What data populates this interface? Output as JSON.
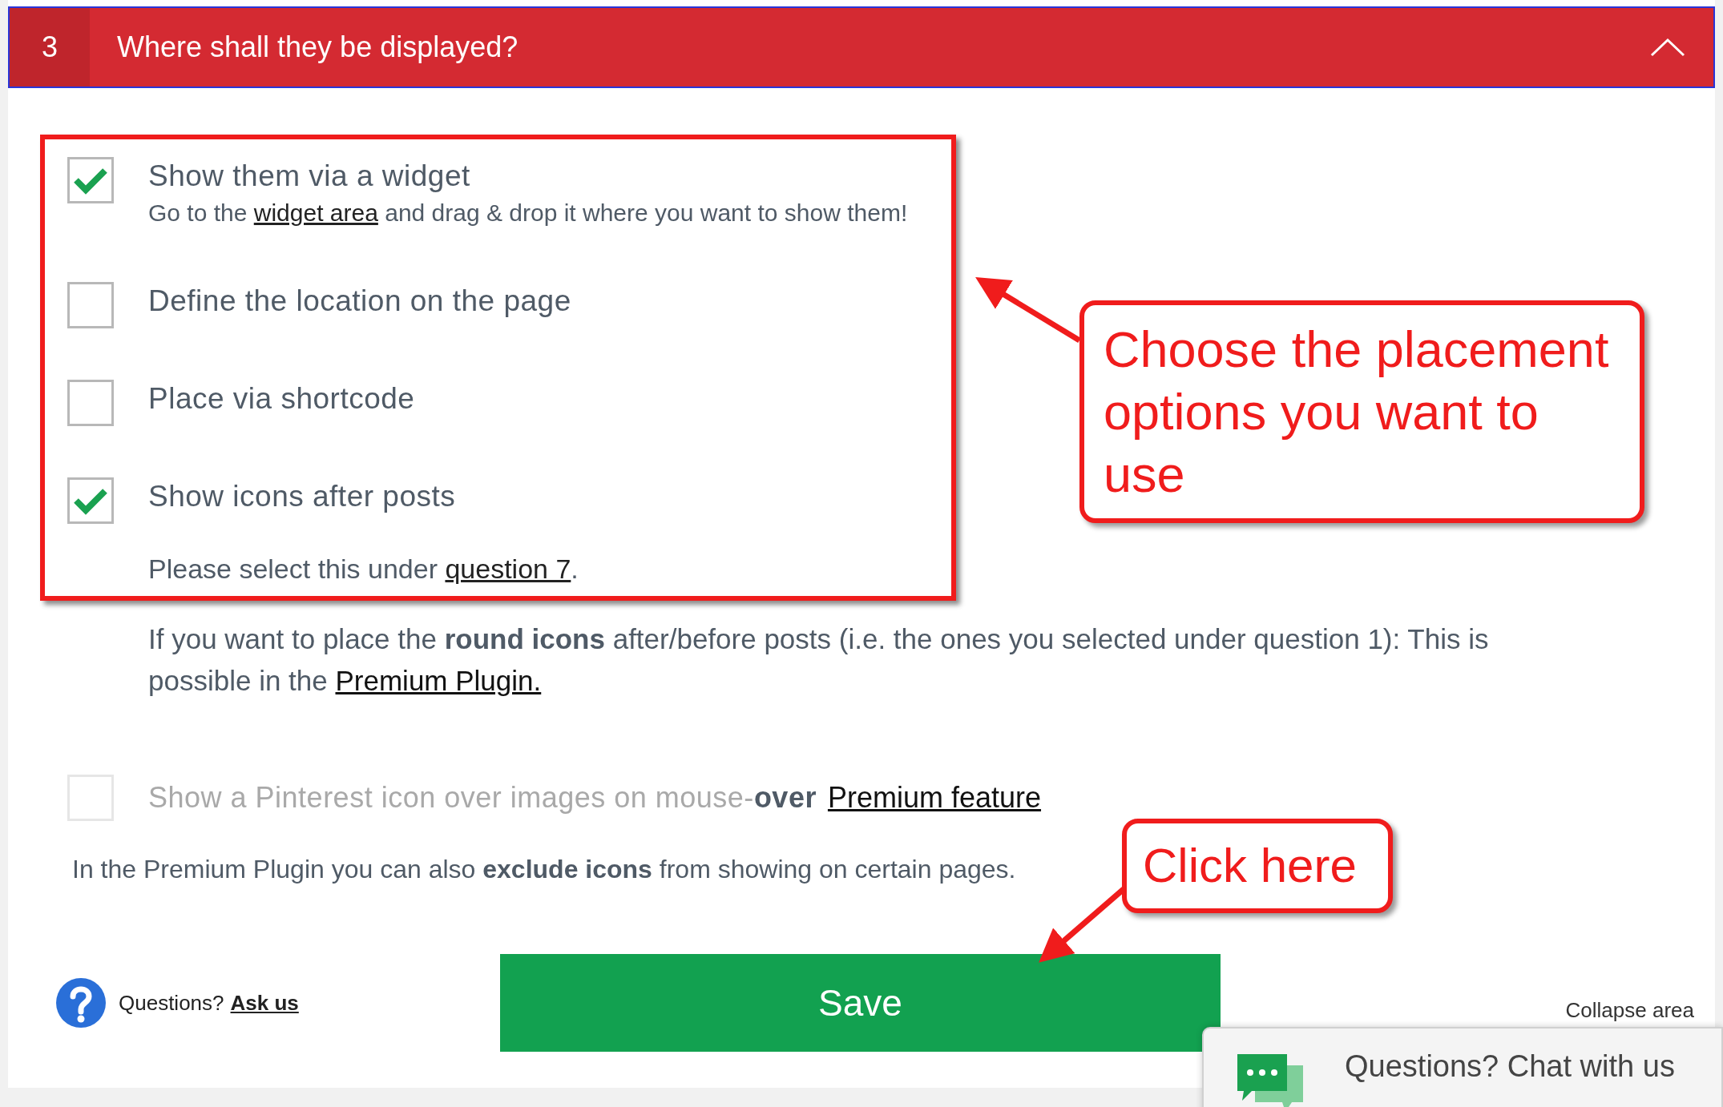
{
  "section": {
    "number": "3",
    "title": "Where shall they be displayed?",
    "expanded": true
  },
  "options": [
    {
      "label": "Show them via a widget",
      "checked": true,
      "note": {
        "before": "Go to the ",
        "link": "widget area",
        "after": " and drag & drop it where you want to show them!"
      }
    },
    {
      "label": "Define the location on the page",
      "checked": false
    },
    {
      "label": "Place via shortcode",
      "checked": false
    },
    {
      "label": "Show icons after posts",
      "checked": true
    }
  ],
  "options_note": {
    "before": "Please select this under ",
    "link": "question 7",
    "after": "."
  },
  "info": {
    "text": "If you want to place the **round icons** after/before posts (i.e. the ones you selected under question 1): This is possible in the ",
    "link": "Premium Plugin."
  },
  "premium_option": {
    "label": "Show a Pinterest icon over images on mouse-**over**",
    "checked": false,
    "disabled": true,
    "link": "Premium feature"
  },
  "exclude_note": "In the Premium Plugin you can also **exclude icons** from showing on certain pages.",
  "help": {
    "text": "Questions?",
    "link": "Ask us"
  },
  "save_button": "Save",
  "collapse_link": "Collapse area",
  "chat": {
    "title": "Questions? Chat with us"
  },
  "annotations": [
    {
      "text": "Choose the placement options you want to use"
    },
    {
      "text": "Click here"
    }
  ]
}
